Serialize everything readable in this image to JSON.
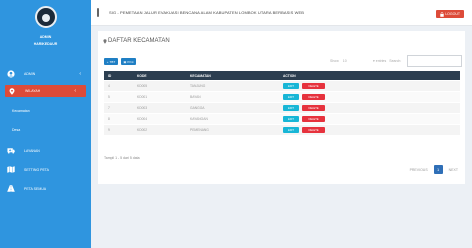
{
  "sidebar": {
    "user_role": "ADMIN",
    "user_name": "HARIKEDAUR",
    "menu": [
      {
        "label": "ADMIN",
        "icon": "user-circle-icon",
        "chevron": "‹"
      },
      {
        "label": "WILAYAH",
        "icon": "map-marker-icon",
        "chevron": "‹",
        "active": true
      },
      {
        "label": "LAYANAN",
        "icon": "ambulance-icon"
      },
      {
        "label": "SETTING PETA",
        "icon": "map-icon"
      },
      {
        "label": "PETA SEMUA",
        "icon": "road-icon"
      }
    ],
    "submenu": [
      "Kecamatan",
      "Desa"
    ]
  },
  "header": {
    "title": "SIG - PEMETAAN JALUR EVAKUASI BENCANA ALAM KABUPATEN LOMBOK UTARA BERBASIS WEB",
    "logout_label": "LOGOUT"
  },
  "content": {
    "page_title": "DAFTAR KECAMATAN",
    "add_label": "TBT",
    "print_label": "Print",
    "show_label": "Show",
    "show_value": "10",
    "entries_label": "entries",
    "search_label": "Search:",
    "columns": [
      "ID",
      "KODE",
      "KECAMATAN",
      "ACTION"
    ],
    "rows": [
      {
        "id": "4",
        "kode": "KD005",
        "kecamatan": "TANJUNG"
      },
      {
        "id": "5",
        "kode": "KD001",
        "kecamatan": "BAYAN"
      },
      {
        "id": "7",
        "kode": "KD003",
        "kecamatan": "GANGGA"
      },
      {
        "id": "8",
        "kode": "KD004",
        "kecamatan": "KAYANGAN"
      },
      {
        "id": "9",
        "kode": "KD002",
        "kecamatan": "PEMENANG"
      }
    ],
    "edit_label": "EDIT",
    "delete_label": "DELETE",
    "info_text": "Tampil 1 - 5 dari 5 data",
    "pagination": {
      "previous": "PREVIOUS",
      "current": "1",
      "next": "NEXT"
    }
  },
  "colors": {
    "sidebar_bg": "#2f95df",
    "active_menu": "#dd4b39",
    "table_header": "#2c3e50",
    "edit_button": "#18b6d6",
    "delete_button": "#e6323d"
  }
}
